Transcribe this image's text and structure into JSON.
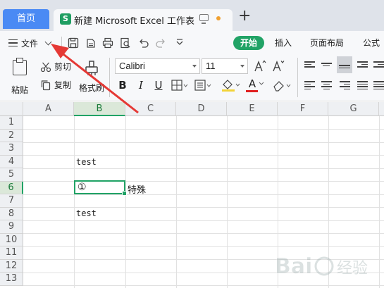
{
  "tabs": {
    "home": "首页",
    "doc_icon": "S",
    "doc_title": "新建 Microsoft Excel 工作表",
    "new_tab": "+"
  },
  "menu": {
    "file": "文件"
  },
  "ribbon_tabs": [
    "开始",
    "插入",
    "页面布局",
    "公式"
  ],
  "ribbon": {
    "paste": "粘贴",
    "cut": "剪切",
    "copy": "复制",
    "format_painter": "格式刷",
    "font_name": "Calibri",
    "font_size": "11",
    "bold": "B",
    "italic": "I",
    "underline": "U",
    "font_color": "A",
    "font_color_hex": "#e02020",
    "fill_color_hex": "#f2d338"
  },
  "columns": [
    "A",
    "B",
    "C",
    "D",
    "E",
    "F",
    "G"
  ],
  "rows": [
    "1",
    "2",
    "3",
    "4",
    "5",
    "6",
    "7",
    "8",
    "9",
    "10",
    "11",
    "12",
    "13"
  ],
  "selected": {
    "column": "B",
    "row": "6"
  },
  "cells": {
    "B4": "test",
    "B6": "①",
    "C6": "特殊",
    "B8": "test"
  },
  "colors": {
    "accent": "#21a366",
    "tab_active": "#4a8af4",
    "annotation_arrow": "#e53935"
  },
  "icons": {
    "save": "save-icon",
    "undo": "undo-icon",
    "redo": "redo-icon",
    "print": "print-icon"
  }
}
